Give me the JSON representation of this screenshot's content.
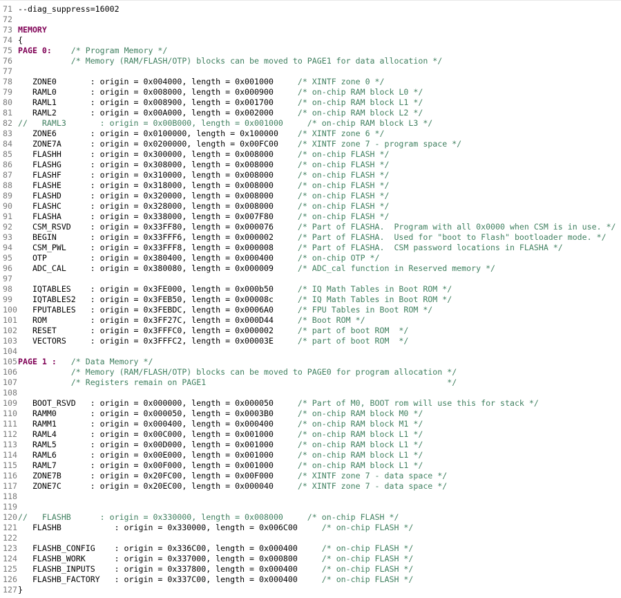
{
  "editor": {
    "colors": {
      "line_number": "#787878",
      "keyword": "#7f0055",
      "comment": "#3f7f5f",
      "text": "#000000",
      "background": "#ffffff"
    },
    "lines": [
      {
        "n": "71",
        "s": [
          {
            "t": "--diag_suppress=16002",
            "k": "code"
          }
        ]
      },
      {
        "n": "72",
        "s": []
      },
      {
        "n": "73",
        "s": [
          {
            "t": "MEMORY",
            "k": "kw"
          }
        ]
      },
      {
        "n": "74",
        "s": [
          {
            "t": "{",
            "k": "code"
          }
        ]
      },
      {
        "n": "75",
        "s": [
          {
            "t": "PAGE 0:",
            "k": "kw"
          },
          {
            "t": "    ",
            "k": "code"
          },
          {
            "t": "/* Program Memory */",
            "k": "cm"
          }
        ]
      },
      {
        "n": "76",
        "s": [
          {
            "t": "           ",
            "k": "code"
          },
          {
            "t": "/* Memory (RAM/FLASH/OTP) blocks can be moved to PAGE1 for data allocation */",
            "k": "cm"
          }
        ]
      },
      {
        "n": "77",
        "s": []
      },
      {
        "n": "78",
        "s": [
          {
            "t": "   ZONE0       : origin = 0x004000, length = 0x001000     ",
            "k": "code"
          },
          {
            "t": "/* XINTF zone 0 */",
            "k": "cm"
          }
        ]
      },
      {
        "n": "79",
        "s": [
          {
            "t": "   RAML0       : origin = 0x008000, length = 0x000900     ",
            "k": "code"
          },
          {
            "t": "/* on-chip RAM block L0 */",
            "k": "cm"
          }
        ]
      },
      {
        "n": "80",
        "s": [
          {
            "t": "   RAML1       : origin = 0x008900, length = 0x001700     ",
            "k": "code"
          },
          {
            "t": "/* on-chip RAM block L1 */",
            "k": "cm"
          }
        ]
      },
      {
        "n": "81",
        "s": [
          {
            "t": "   RAML2       : origin = 0x00A000, length = 0x002000     ",
            "k": "code"
          },
          {
            "t": "/* on-chip RAM block L2 */",
            "k": "cm"
          }
        ]
      },
      {
        "n": "82",
        "s": [
          {
            "t": "//   RAML3       : origin = 0x00B000, length = 0x001000     /* on-chip RAM block L3 */",
            "k": "cm"
          }
        ]
      },
      {
        "n": "83",
        "s": [
          {
            "t": "   ZONE6       : origin = 0x0100000, length = 0x100000    ",
            "k": "code"
          },
          {
            "t": "/* XINTF zone 6 */",
            "k": "cm"
          }
        ]
      },
      {
        "n": "84",
        "s": [
          {
            "t": "   ZONE7A      : origin = 0x0200000, length = 0x00FC00    ",
            "k": "code"
          },
          {
            "t": "/* XINTF zone 7 - program space */",
            "k": "cm"
          }
        ]
      },
      {
        "n": "85",
        "s": [
          {
            "t": "   FLASHH      : origin = 0x300000, length = 0x008000     ",
            "k": "code"
          },
          {
            "t": "/* on-chip FLASH */",
            "k": "cm"
          }
        ]
      },
      {
        "n": "86",
        "s": [
          {
            "t": "   FLASHG      : origin = 0x308000, length = 0x008000     ",
            "k": "code"
          },
          {
            "t": "/* on-chip FLASH */",
            "k": "cm"
          }
        ]
      },
      {
        "n": "87",
        "s": [
          {
            "t": "   FLASHF      : origin = 0x310000, length = 0x008000     ",
            "k": "code"
          },
          {
            "t": "/* on-chip FLASH */",
            "k": "cm"
          }
        ]
      },
      {
        "n": "88",
        "s": [
          {
            "t": "   FLASHE      : origin = 0x318000, length = 0x008000     ",
            "k": "code"
          },
          {
            "t": "/* on-chip FLASH */",
            "k": "cm"
          }
        ]
      },
      {
        "n": "89",
        "s": [
          {
            "t": "   FLASHD      : origin = 0x320000, length = 0x008000     ",
            "k": "code"
          },
          {
            "t": "/* on-chip FLASH */",
            "k": "cm"
          }
        ]
      },
      {
        "n": "90",
        "s": [
          {
            "t": "   FLASHC      : origin = 0x328000, length = 0x008000     ",
            "k": "code"
          },
          {
            "t": "/* on-chip FLASH */",
            "k": "cm"
          }
        ]
      },
      {
        "n": "91",
        "s": [
          {
            "t": "   FLASHA      : origin = 0x338000, length = 0x007F80     ",
            "k": "code"
          },
          {
            "t": "/* on-chip FLASH */",
            "k": "cm"
          }
        ]
      },
      {
        "n": "92",
        "s": [
          {
            "t": "   CSM_RSVD    : origin = 0x33FF80, length = 0x000076     ",
            "k": "code"
          },
          {
            "t": "/* Part of FLASHA.  Program with all 0x0000 when CSM is in use. */",
            "k": "cm"
          }
        ]
      },
      {
        "n": "93",
        "s": [
          {
            "t": "   BEGIN       : origin = 0x33FFF6, length = 0x000002     ",
            "k": "code"
          },
          {
            "t": "/* Part of FLASHA.  Used for \"boot to Flash\" bootloader mode. */",
            "k": "cm"
          }
        ]
      },
      {
        "n": "94",
        "s": [
          {
            "t": "   CSM_PWL     : origin = 0x33FFF8, length = 0x000008     ",
            "k": "code"
          },
          {
            "t": "/* Part of FLASHA.  CSM password locations in FLASHA */",
            "k": "cm"
          }
        ]
      },
      {
        "n": "95",
        "s": [
          {
            "t": "   OTP         : origin = 0x380400, length = 0x000400     ",
            "k": "code"
          },
          {
            "t": "/* on-chip OTP */",
            "k": "cm"
          }
        ]
      },
      {
        "n": "96",
        "s": [
          {
            "t": "   ADC_CAL     : origin = 0x380080, length = 0x000009     ",
            "k": "code"
          },
          {
            "t": "/* ADC_cal function in Reserved memory */",
            "k": "cm"
          }
        ]
      },
      {
        "n": "97",
        "s": []
      },
      {
        "n": "98",
        "s": [
          {
            "t": "   IQTABLES    : origin = 0x3FE000, length = 0x000b50     ",
            "k": "code"
          },
          {
            "t": "/* IQ Math Tables in Boot ROM */",
            "k": "cm"
          }
        ]
      },
      {
        "n": "99",
        "s": [
          {
            "t": "   IQTABLES2   : origin = 0x3FEB50, length = 0x00008c     ",
            "k": "code"
          },
          {
            "t": "/* IQ Math Tables in Boot ROM */",
            "k": "cm"
          }
        ]
      },
      {
        "n": "100",
        "s": [
          {
            "t": "   FPUTABLES   : origin = 0x3FEBDC, length = 0x0006A0     ",
            "k": "code"
          },
          {
            "t": "/* FPU Tables in Boot ROM */",
            "k": "cm"
          }
        ]
      },
      {
        "n": "101",
        "s": [
          {
            "t": "   ROM         : origin = 0x3FF27C, length = 0x000D44     ",
            "k": "code"
          },
          {
            "t": "/* Boot ROM */",
            "k": "cm"
          }
        ]
      },
      {
        "n": "102",
        "s": [
          {
            "t": "   RESET       : origin = 0x3FFFC0, length = 0x000002     ",
            "k": "code"
          },
          {
            "t": "/* part of boot ROM  */",
            "k": "cm"
          }
        ]
      },
      {
        "n": "103",
        "s": [
          {
            "t": "   VECTORS     : origin = 0x3FFFC2, length = 0x00003E     ",
            "k": "code"
          },
          {
            "t": "/* part of boot ROM  */",
            "k": "cm"
          }
        ]
      },
      {
        "n": "104",
        "s": []
      },
      {
        "n": "105",
        "s": [
          {
            "t": "PAGE 1 :",
            "k": "kw"
          },
          {
            "t": "   ",
            "k": "code"
          },
          {
            "t": "/* Data Memory */",
            "k": "cm"
          }
        ]
      },
      {
        "n": "106",
        "s": [
          {
            "t": "           ",
            "k": "code"
          },
          {
            "t": "/* Memory (RAM/FLASH/OTP) blocks can be moved to PAGE0 for program allocation */",
            "k": "cm"
          }
        ]
      },
      {
        "n": "107",
        "s": [
          {
            "t": "           ",
            "k": "code"
          },
          {
            "t": "/* Registers remain on PAGE1                                                  */",
            "k": "cm"
          }
        ]
      },
      {
        "n": "108",
        "s": []
      },
      {
        "n": "109",
        "s": [
          {
            "t": "   BOOT_RSVD   : origin = 0x000000, length = 0x000050     ",
            "k": "code"
          },
          {
            "t": "/* Part of M0, BOOT rom will use this for stack */",
            "k": "cm"
          }
        ]
      },
      {
        "n": "110",
        "s": [
          {
            "t": "   RAMM0       : origin = 0x000050, length = 0x0003B0     ",
            "k": "code"
          },
          {
            "t": "/* on-chip RAM block M0 */",
            "k": "cm"
          }
        ]
      },
      {
        "n": "111",
        "s": [
          {
            "t": "   RAMM1       : origin = 0x000400, length = 0x000400     ",
            "k": "code"
          },
          {
            "t": "/* on-chip RAM block M1 */",
            "k": "cm"
          }
        ]
      },
      {
        "n": "112",
        "s": [
          {
            "t": "   RAML4       : origin = 0x00C000, length = 0x001000     ",
            "k": "code"
          },
          {
            "t": "/* on-chip RAM block L1 */",
            "k": "cm"
          }
        ]
      },
      {
        "n": "113",
        "s": [
          {
            "t": "   RAML5       : origin = 0x00D000, length = 0x001000     ",
            "k": "code"
          },
          {
            "t": "/* on-chip RAM block L1 */",
            "k": "cm"
          }
        ]
      },
      {
        "n": "114",
        "s": [
          {
            "t": "   RAML6       : origin = 0x00E000, length = 0x001000     ",
            "k": "code"
          },
          {
            "t": "/* on-chip RAM block L1 */",
            "k": "cm"
          }
        ]
      },
      {
        "n": "115",
        "s": [
          {
            "t": "   RAML7       : origin = 0x00F000, length = 0x001000     ",
            "k": "code"
          },
          {
            "t": "/* on-chip RAM block L1 */",
            "k": "cm"
          }
        ]
      },
      {
        "n": "116",
        "s": [
          {
            "t": "   ZONE7B      : origin = 0x20FC00, length = 0x00F000     ",
            "k": "code"
          },
          {
            "t": "/* XINTF zone 7 - data space */",
            "k": "cm"
          }
        ]
      },
      {
        "n": "117",
        "s": [
          {
            "t": "   ZONE7C      : origin = 0x20EC00, length = 0x000040     ",
            "k": "code"
          },
          {
            "t": "/* XINTF zone 7 - data space */",
            "k": "cm"
          }
        ]
      },
      {
        "n": "118",
        "s": []
      },
      {
        "n": "119",
        "s": []
      },
      {
        "n": "120",
        "s": [
          {
            "t": "//   FLASHB      : origin = 0x330000, length = 0x008000     /* on-chip FLASH */",
            "k": "cm"
          }
        ]
      },
      {
        "n": "121",
        "s": [
          {
            "t": "   FLASHB           : origin = 0x330000, length = 0x006C00     ",
            "k": "code"
          },
          {
            "t": "/* on-chip FLASH */",
            "k": "cm"
          }
        ]
      },
      {
        "n": "122",
        "s": []
      },
      {
        "n": "123",
        "s": [
          {
            "t": "   FLASHB_CONFIG    : origin = 0x336C00, length = 0x000400     ",
            "k": "code"
          },
          {
            "t": "/* on-chip FLASH */",
            "k": "cm"
          }
        ]
      },
      {
        "n": "124",
        "s": [
          {
            "t": "   FLASHB_WORK      : origin = 0x337000, length = 0x000800     ",
            "k": "code"
          },
          {
            "t": "/* on-chip FLASH */",
            "k": "cm"
          }
        ]
      },
      {
        "n": "125",
        "s": [
          {
            "t": "   FLASHB_INPUTS    : origin = 0x337800, length = 0x000400     ",
            "k": "code"
          },
          {
            "t": "/* on-chip FLASH */",
            "k": "cm"
          }
        ]
      },
      {
        "n": "126",
        "s": [
          {
            "t": "   FLASHB_FACTORY   : origin = 0x337C00, length = 0x000400     ",
            "k": "code"
          },
          {
            "t": "/* on-chip FLASH */",
            "k": "cm"
          }
        ]
      },
      {
        "n": "127",
        "s": [
          {
            "t": "}",
            "k": "code"
          }
        ]
      }
    ]
  }
}
